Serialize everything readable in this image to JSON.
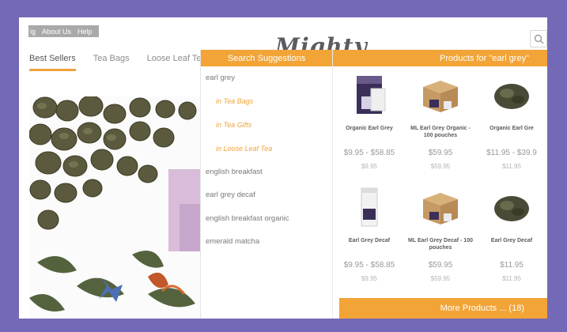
{
  "util_links": [
    "ig",
    "About Us",
    "Help"
  ],
  "logo_text": "Mighty",
  "nav": [
    "Best Sellers",
    "Tea Bags",
    "Loose Leaf Te"
  ],
  "search": {
    "suggestions_header": "Search Suggestions",
    "products_header": "Products for \"earl grey\"",
    "suggestions": [
      {
        "text": "earl grey",
        "type": "term"
      },
      {
        "text": "in Tea Bags",
        "type": "category"
      },
      {
        "text": "in Tea Gifts",
        "type": "category"
      },
      {
        "text": "in Loose Leaf Tea",
        "type": "category"
      },
      {
        "text": "english breakfast",
        "type": "term"
      },
      {
        "text": "earl grey decaf",
        "type": "term"
      },
      {
        "text": "english breakfast organic",
        "type": "term"
      },
      {
        "text": "emerald matcha",
        "type": "term"
      }
    ],
    "products": [
      {
        "name": "Organic Earl Grey",
        "price": "$9.95 - $58.85",
        "price2": "$9.95",
        "image": "box"
      },
      {
        "name": "ML Earl Grey Organic - 100 pouches",
        "price": "$59.95",
        "price2": "$59.95",
        "image": "carton"
      },
      {
        "name": "Organic Earl Gre",
        "price": "$11.95 - $39.9",
        "price2": "$11.95",
        "image": "leaves"
      },
      {
        "name": "Earl Grey Decaf",
        "price": "$9.95 - $58.85",
        "price2": "$9.95",
        "image": "tin"
      },
      {
        "name": "ML Earl Grey Decaf - 100 pouches",
        "price": "$59.95",
        "price2": "$59.95",
        "image": "carton"
      },
      {
        "name": "Earl Grey Decaf",
        "price": "$11.95",
        "price2": "$11.95",
        "image": "leaves"
      }
    ],
    "more_button": "More Products ... (18)"
  },
  "colors": {
    "accent": "#f2a437",
    "border": "#7469b6"
  }
}
